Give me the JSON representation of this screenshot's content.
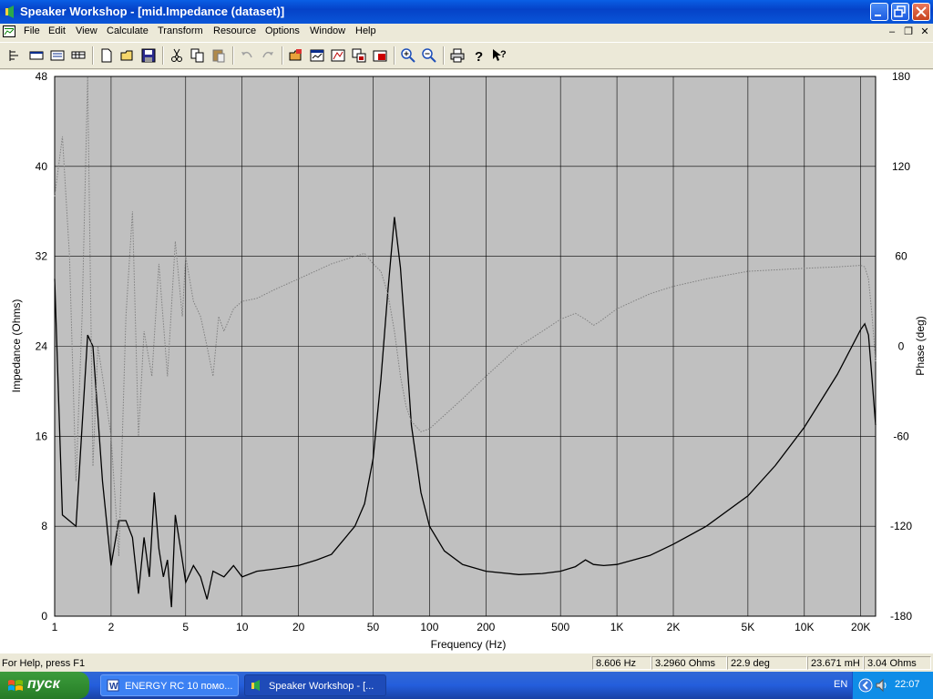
{
  "window": {
    "title": "Speaker Workshop - [mid.Impedance (dataset)]"
  },
  "menu": [
    "File",
    "Edit",
    "View",
    "Calculate",
    "Transform",
    "Resource",
    "Options",
    "Window",
    "Help"
  ],
  "toolbar": {
    "buttons": [
      "properties-icon",
      "dialog-icon",
      "chart-icon",
      "grid-icon",
      "new-icon",
      "open-icon",
      "save-icon",
      "cut-icon",
      "copy-icon",
      "paste-icon",
      "undo-icon",
      "redo-icon",
      "open-folder-icon",
      "measure-icon",
      "graph-icon",
      "export-icon",
      "import-icon",
      "zoom-in-icon",
      "zoom-out-icon",
      "print-icon",
      "help-icon",
      "context-help-icon"
    ]
  },
  "chart_data": {
    "type": "line",
    "x_scale": "log",
    "xlabel": "Frequency (Hz)",
    "ylabel": "Impedance (Ohms)",
    "y2label": "Phase (deg)",
    "xlim": [
      1,
      24000
    ],
    "ylim": [
      0,
      48
    ],
    "y2lim": [
      -180,
      180
    ],
    "x_ticks": [
      "1",
      "2",
      "5",
      "10",
      "20",
      "50",
      "100",
      "200",
      "500",
      "1K",
      "2K",
      "5K",
      "10K",
      "20K"
    ],
    "y_ticks": [
      "0",
      "8",
      "16",
      "24",
      "32",
      "40",
      "48"
    ],
    "y2_ticks": [
      "-180",
      "-120",
      "-60",
      "0",
      "60",
      "120",
      "180"
    ],
    "grid": true,
    "series": [
      {
        "axis": "left",
        "style": "solid",
        "color": "#000000",
        "points": [
          [
            1,
            30
          ],
          [
            1.1,
            9
          ],
          [
            1.3,
            8
          ],
          [
            1.5,
            25
          ],
          [
            1.6,
            24
          ],
          [
            1.8,
            12
          ],
          [
            2,
            4.5
          ],
          [
            2.2,
            8.5
          ],
          [
            2.4,
            8.5
          ],
          [
            2.6,
            7
          ],
          [
            2.8,
            2
          ],
          [
            3,
            7
          ],
          [
            3.2,
            3.5
          ],
          [
            3.4,
            11
          ],
          [
            3.6,
            6
          ],
          [
            3.8,
            3.5
          ],
          [
            4,
            5
          ],
          [
            4.2,
            0.8
          ],
          [
            4.4,
            9
          ],
          [
            4.7,
            6
          ],
          [
            5,
            3
          ],
          [
            5.5,
            4.5
          ],
          [
            6,
            3.5
          ],
          [
            6.5,
            1.5
          ],
          [
            7,
            4
          ],
          [
            8,
            3.5
          ],
          [
            9,
            4.5
          ],
          [
            10,
            3.5
          ],
          [
            12,
            4
          ],
          [
            15,
            4.2
          ],
          [
            20,
            4.5
          ],
          [
            25,
            5
          ],
          [
            30,
            5.5
          ],
          [
            40,
            8
          ],
          [
            45,
            10
          ],
          [
            50,
            14
          ],
          [
            55,
            21
          ],
          [
            60,
            29
          ],
          [
            65,
            35.5
          ],
          [
            70,
            31
          ],
          [
            75,
            24
          ],
          [
            80,
            17
          ],
          [
            90,
            11
          ],
          [
            100,
            8
          ],
          [
            120,
            5.8
          ],
          [
            150,
            4.6
          ],
          [
            200,
            4.0
          ],
          [
            300,
            3.7
          ],
          [
            400,
            3.8
          ],
          [
            500,
            4.0
          ],
          [
            600,
            4.4
          ],
          [
            680,
            5.0
          ],
          [
            750,
            4.6
          ],
          [
            850,
            4.5
          ],
          [
            1000,
            4.6
          ],
          [
            1500,
            5.4
          ],
          [
            2000,
            6.4
          ],
          [
            3000,
            8.0
          ],
          [
            5000,
            10.7
          ],
          [
            7000,
            13.4
          ],
          [
            10000,
            16.8
          ],
          [
            15000,
            21.5
          ],
          [
            20000,
            25.5
          ],
          [
            21000,
            26
          ],
          [
            22000,
            25
          ],
          [
            23000,
            21
          ],
          [
            24000,
            17
          ]
        ]
      },
      {
        "axis": "right",
        "style": "dotted",
        "color": "#808080",
        "points": [
          [
            1,
            100
          ],
          [
            1.1,
            140
          ],
          [
            1.2,
            60
          ],
          [
            1.3,
            -90
          ],
          [
            1.4,
            20
          ],
          [
            1.5,
            180
          ],
          [
            1.6,
            -80
          ],
          [
            1.7,
            0
          ],
          [
            1.8,
            -20
          ],
          [
            2,
            -60
          ],
          [
            2.2,
            -140
          ],
          [
            2.4,
            20
          ],
          [
            2.6,
            90
          ],
          [
            2.8,
            -60
          ],
          [
            3,
            10
          ],
          [
            3.3,
            -20
          ],
          [
            3.6,
            55
          ],
          [
            4,
            -20
          ],
          [
            4.4,
            70
          ],
          [
            4.8,
            20
          ],
          [
            5,
            60
          ],
          [
            5.5,
            30
          ],
          [
            6,
            20
          ],
          [
            6.5,
            0
          ],
          [
            7,
            -20
          ],
          [
            7.5,
            20
          ],
          [
            8,
            10
          ],
          [
            9,
            25
          ],
          [
            10,
            30
          ],
          [
            12,
            32
          ],
          [
            15,
            38
          ],
          [
            20,
            45
          ],
          [
            30,
            55
          ],
          [
            40,
            60
          ],
          [
            45,
            62
          ],
          [
            50,
            55
          ],
          [
            55,
            50
          ],
          [
            60,
            35
          ],
          [
            65,
            10
          ],
          [
            70,
            -20
          ],
          [
            75,
            -40
          ],
          [
            80,
            -50
          ],
          [
            90,
            -57
          ],
          [
            100,
            -55
          ],
          [
            150,
            -35
          ],
          [
            200,
            -20
          ],
          [
            300,
            0
          ],
          [
            400,
            10
          ],
          [
            500,
            18
          ],
          [
            600,
            22
          ],
          [
            680,
            18
          ],
          [
            750,
            14
          ],
          [
            800,
            16
          ],
          [
            1000,
            25
          ],
          [
            1500,
            35
          ],
          [
            2000,
            40
          ],
          [
            3000,
            45
          ],
          [
            5000,
            50
          ],
          [
            10000,
            52
          ],
          [
            15000,
            53
          ],
          [
            20000,
            54
          ],
          [
            21000,
            53
          ],
          [
            22000,
            45
          ],
          [
            23000,
            20
          ],
          [
            24000,
            -10
          ]
        ]
      }
    ]
  },
  "status": {
    "help": "For Help, press F1",
    "frequency": "8.606 Hz",
    "impedance": "3.2960 Ohms",
    "phase": "22.9 deg",
    "inductance": "23.671 mH",
    "resistance": "3.04 Ohms"
  },
  "taskbar": {
    "start_label": "пуск",
    "tasks": [
      {
        "label": "ENERGY RC 10 помо...",
        "active": false
      },
      {
        "label": "Speaker Workshop - [...",
        "active": true
      }
    ],
    "language": "EN",
    "clock": "22:07"
  }
}
